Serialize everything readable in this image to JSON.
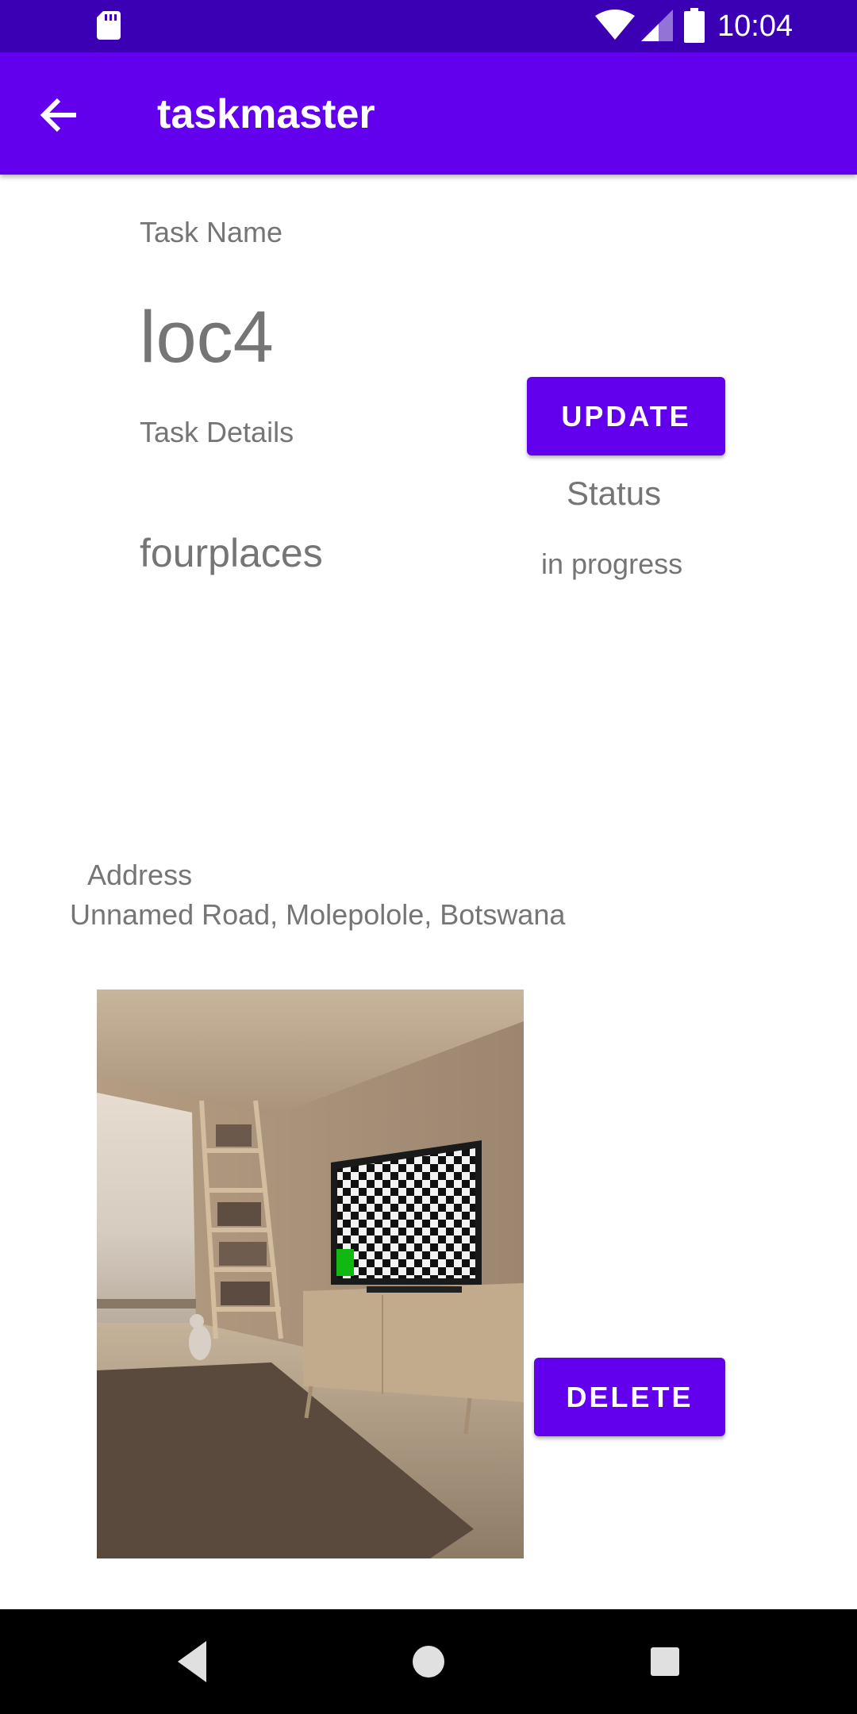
{
  "status_bar": {
    "time": "10:04"
  },
  "app_bar": {
    "title": "taskmaster"
  },
  "task": {
    "name_label": "Task Name",
    "name": "loc4",
    "details_label": "Task Details",
    "details": "fourplaces",
    "status_label": "Status",
    "status": "in progress",
    "address_label": "Address",
    "address": "Unnamed Road, Molepolole, Botswana"
  },
  "buttons": {
    "update": "UPDATE",
    "delete": "DELETE"
  },
  "colors": {
    "primary": "#6200ee",
    "primary_dark": "#3b00b3",
    "text_secondary": "#757575"
  }
}
